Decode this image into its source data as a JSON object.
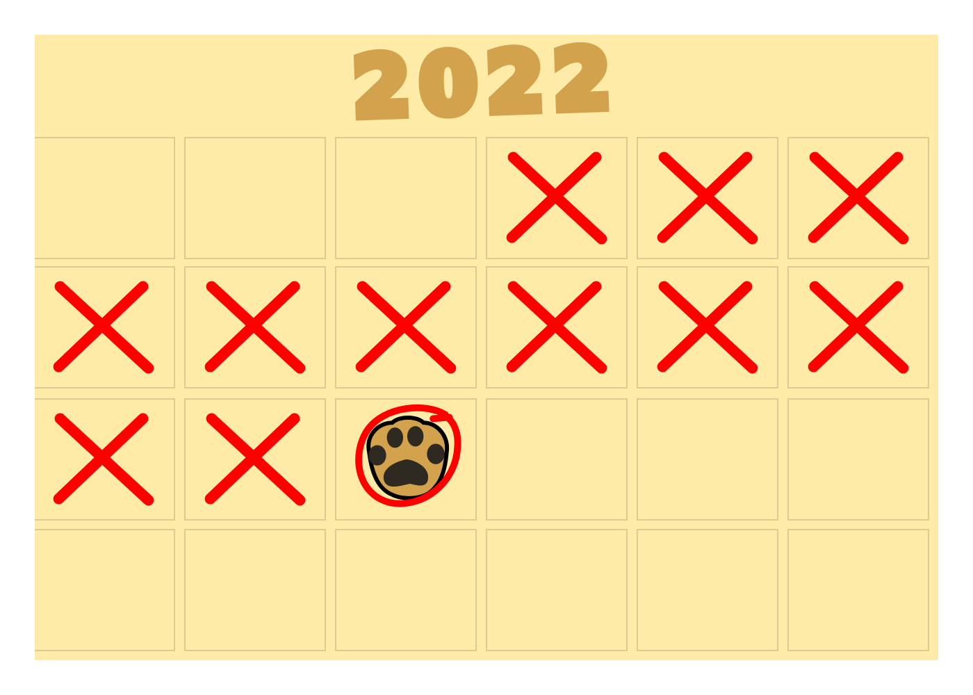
{
  "title": "2022",
  "colors": {
    "background": "#fdeba7",
    "title": "#d2a24c",
    "cell_border": "#dccb93",
    "mark": "#ff0000",
    "paw_fill": "#d2a24c",
    "paw_pad": "#2e2a22"
  },
  "grid": {
    "columns": 6,
    "rows": [
      [
        "empty",
        "empty",
        "empty",
        "x",
        "x",
        "x"
      ],
      [
        "x",
        "x",
        "x",
        "x",
        "x",
        "x"
      ],
      [
        "x",
        "x",
        "paw-circled",
        "empty",
        "empty",
        "empty"
      ],
      [
        "empty",
        "empty",
        "empty",
        "empty",
        "empty",
        "empty"
      ]
    ]
  }
}
